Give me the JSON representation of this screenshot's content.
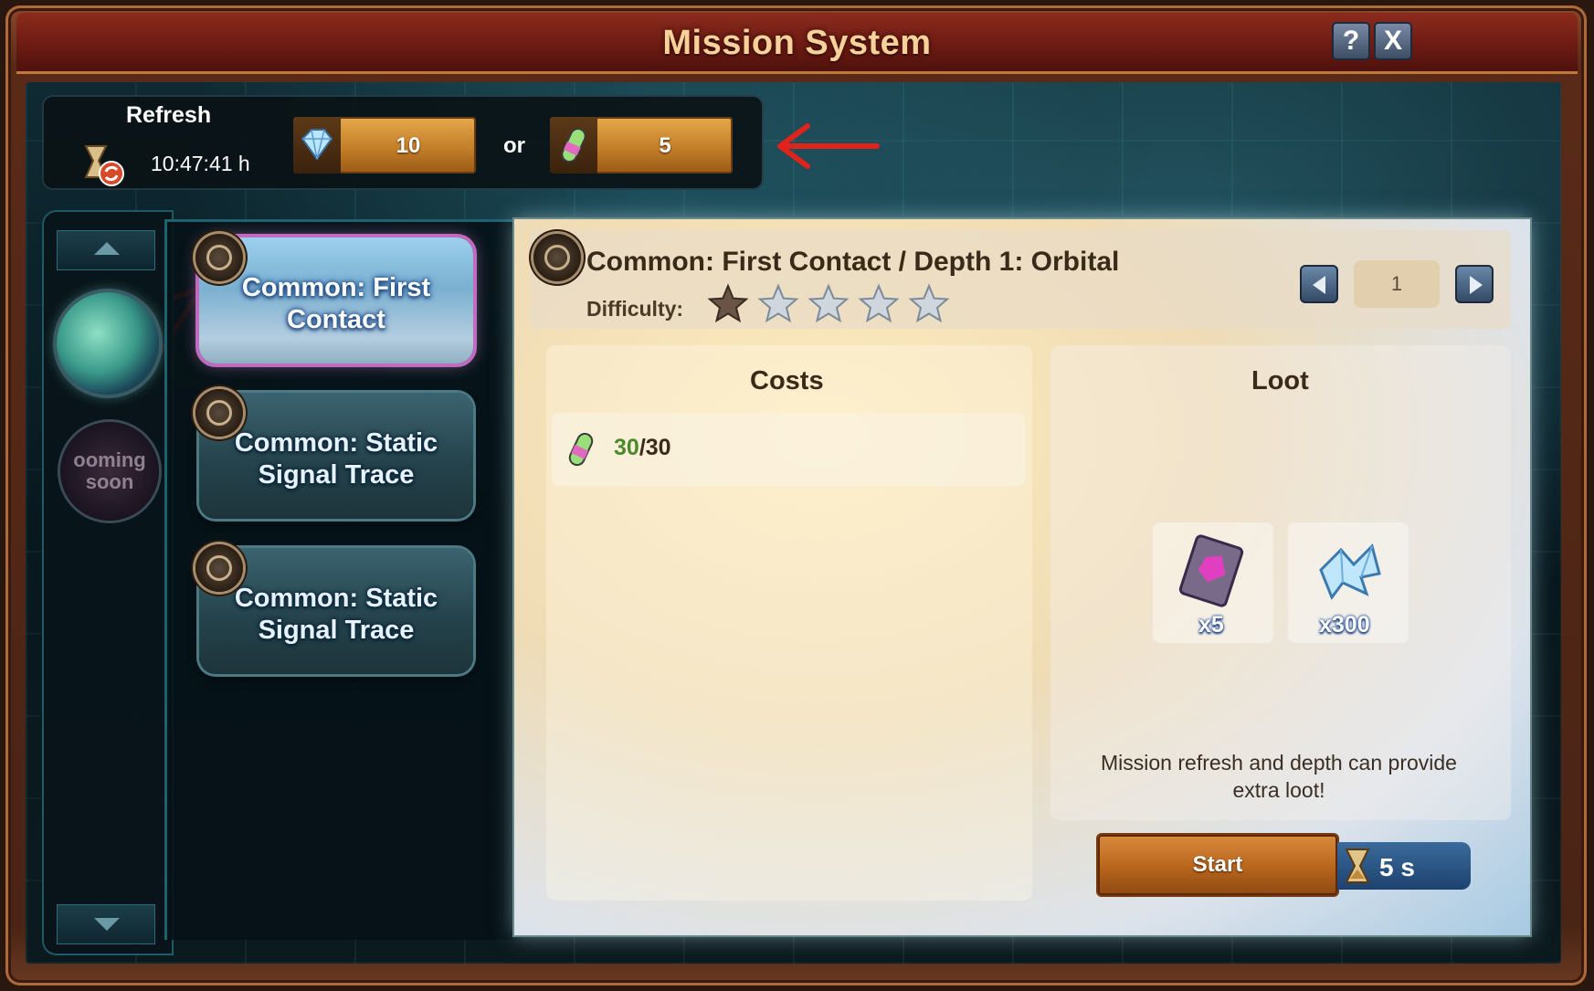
{
  "window": {
    "title": "Mission System",
    "help_label": "?",
    "close_label": "X"
  },
  "refresh": {
    "label": "Refresh",
    "timer": "10:47:41 h",
    "option_diamonds": {
      "icon": "diamond-icon",
      "value": "10"
    },
    "or_label": "or",
    "option_tokens": {
      "icon": "mission-token-icon",
      "value": "5"
    }
  },
  "sidebar": {
    "planet_icon": "planet-icon",
    "coming_soon": "ooming\nsoon"
  },
  "missions": [
    {
      "label": "Common: First Contact",
      "selected": true
    },
    {
      "label": "Common: Static Signal Trace",
      "selected": false
    },
    {
      "label": "Common: Static Signal Trace",
      "selected": false
    }
  ],
  "detail": {
    "title": "Common: First Contact / Depth 1: Orbital",
    "difficulty_label": "Difficulty:",
    "difficulty_filled": 1,
    "difficulty_max": 5,
    "depth_value": "1",
    "costs_header": "Costs",
    "cost": {
      "icon": "mission-token-icon",
      "have": "30",
      "need": "/30"
    },
    "loot_header": "Loot",
    "loot": [
      {
        "icon": "card-icon",
        "amount": "x5"
      },
      {
        "icon": "crystal-icon",
        "amount": "x300"
      }
    ],
    "note": "Mission refresh and depth can provide extra loot!",
    "start_label": "Start",
    "duration": "5 s"
  },
  "colors": {
    "accent_orange": "#c47f28",
    "annotation_red": "#e0241c",
    "selected_glow": "#c06ac0"
  }
}
